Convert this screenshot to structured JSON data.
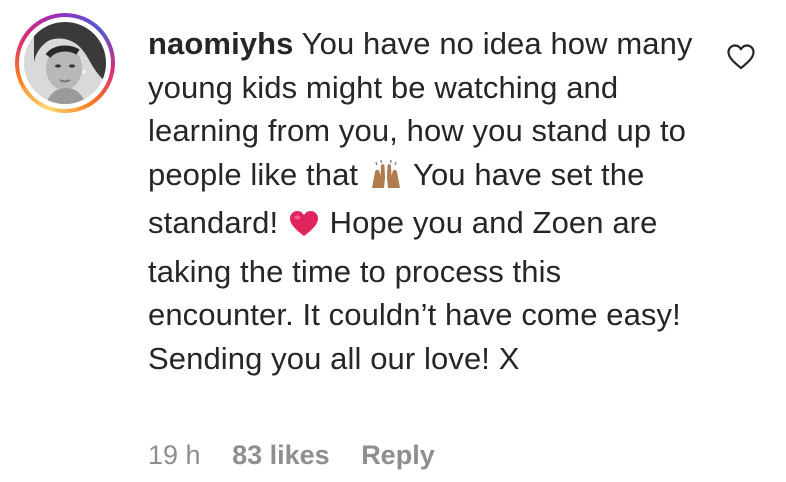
{
  "comment": {
    "username": "naomiyhs",
    "text_part1": "You have no idea how many young kids might be watching and learning from you, how you stand up to people like that",
    "text_part2": "You have set the standard!",
    "text_part3": "Hope you and Zoen are taking the time to process this encounter. It couldn’t have come easy! Sending you all our love! X",
    "emojis": [
      "raising-hands-icon",
      "red-heart-icon"
    ],
    "timestamp": "19 h",
    "likes": "83 likes",
    "reply_label": "Reply"
  },
  "colors": {
    "text": "#262626",
    "meta": "#8e8e8e",
    "heart": "#e0245e",
    "ring_start": "#feda75",
    "ring_end": "#d62976"
  },
  "icons": {
    "like": "heart-outline-icon",
    "avatar": "profile-photo"
  }
}
